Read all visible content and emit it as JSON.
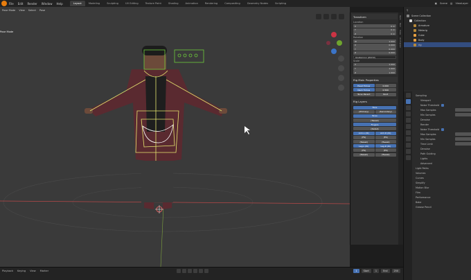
{
  "menu": [
    "File",
    "Edit",
    "Render",
    "Window",
    "Help"
  ],
  "workspace_tabs": [
    {
      "label": "Layout",
      "active": true
    },
    {
      "label": "Modeling",
      "active": false
    },
    {
      "label": "Sculpting",
      "active": false
    },
    {
      "label": "UV Editing",
      "active": false
    },
    {
      "label": "Texture Paint",
      "active": false
    },
    {
      "label": "Shading",
      "active": false
    },
    {
      "label": "Animation",
      "active": false
    },
    {
      "label": "Rendering",
      "active": false
    },
    {
      "label": "Compositing",
      "active": false
    },
    {
      "label": "Geometry Nodes",
      "active": false
    },
    {
      "label": "Scripting",
      "active": false
    }
  ],
  "top_right": {
    "scene": "Scene",
    "view_layer": "ViewLayer"
  },
  "viewport": {
    "menu": [
      "Pose Mode",
      "View",
      "Select",
      "Pose"
    ],
    "mode_text": "Pose Mode",
    "colors": {
      "bg": "#3a3a3a",
      "bone": "#e8e870",
      "ctrl": "#6ecc3a",
      "axis_x": "#b84848",
      "axis_y": "#7ea33e"
    }
  },
  "npanel": {
    "tabs": [
      "Item",
      "Tool",
      "View",
      "Animation"
    ],
    "transform": {
      "title": "Transform",
      "location_label": "Location",
      "location": [
        "0 m",
        "0 m",
        "0 m"
      ],
      "rotation_label": "Rotation",
      "rotation": [
        "1.000",
        "0.000",
        "0.000",
        "0.000"
      ],
      "rotation_mode": "Quaternion (WXYZ)",
      "scale_label": "Scale",
      "scale": [
        "1.000",
        "1.000",
        "1.000"
      ]
    },
    "rig_main": {
      "title": "Rig Main Properties",
      "rows": [
        {
          "label": "Head Follow",
          "value": "0.000"
        },
        {
          "label": "Neck Follow",
          "value": "0.500"
        },
        {
          "label": "Torso Parent",
          "value": "Root"
        }
      ]
    },
    "rig_layers": {
      "title": "Rig Layers",
      "buttons": [
        [
          "Face"
        ],
        [
          "(Primary)",
          "(Secondary)"
        ],
        [
          "Torso"
        ],
        [
          "(Tweak)"
        ],
        [
          "Fingers"
        ],
        [
          "(Detail)"
        ],
        [
          "Arm.L (IK)",
          "Arm.R (IK)"
        ],
        [
          "(FK)",
          "(FK)"
        ],
        [
          "(Tweak)",
          "(Tweak)"
        ],
        [
          "Leg.L (IK)",
          "Leg.R (IK)"
        ],
        [
          "(FK)",
          "(FK)"
        ],
        [
          "(Tweak)",
          "(Tweak)"
        ]
      ]
    }
  },
  "outliner": {
    "items": [
      {
        "label": "Scene Collection",
        "selected": false
      },
      {
        "label": "Collection",
        "selected": false
      },
      {
        "label": "Armature",
        "selected": false
      },
      {
        "label": "Metarig",
        "selected": false
      },
      {
        "label": "Cube",
        "selected": false
      },
      {
        "label": "Body",
        "selected": false
      },
      {
        "label": "rig",
        "selected": true
      }
    ]
  },
  "properties": {
    "rows": [
      {
        "label": "Sampling",
        "type": "head"
      },
      {
        "label": "Viewport",
        "type": "sub"
      },
      {
        "label": "Noise Threshold",
        "type": "check"
      },
      {
        "label": "Max Samples",
        "type": "value"
      },
      {
        "label": "Min Samples",
        "type": "value"
      },
      {
        "label": "Denoise",
        "type": "sub"
      },
      {
        "label": "Render",
        "type": "sub"
      },
      {
        "label": "Noise Threshold",
        "type": "check"
      },
      {
        "label": "Max Samples",
        "type": "value"
      },
      {
        "label": "Min Samples",
        "type": "value"
      },
      {
        "label": "Time Limit",
        "type": "value"
      },
      {
        "label": "Denoise",
        "type": "sub"
      },
      {
        "label": "Path Guiding",
        "type": "sub"
      },
      {
        "label": "Lights",
        "type": "sub"
      },
      {
        "label": "Advanced",
        "type": "sub"
      },
      {
        "label": "Light Paths",
        "type": "head"
      },
      {
        "label": "Volumes",
        "type": "head"
      },
      {
        "label": "Curves",
        "type": "head"
      },
      {
        "label": "Simplify",
        "type": "head"
      },
      {
        "label": "Motion Blur",
        "type": "head"
      },
      {
        "label": "Film",
        "type": "head"
      },
      {
        "label": "Performance",
        "type": "head"
      },
      {
        "label": "Bake",
        "type": "head"
      },
      {
        "label": "Grease Pencil",
        "type": "head"
      }
    ]
  },
  "timeline": {
    "menu": [
      "Playback",
      "Keying",
      "View",
      "Marker"
    ],
    "current_frame": "1",
    "start_label": "Start",
    "start": "1",
    "end_label": "End",
    "end": "250"
  }
}
